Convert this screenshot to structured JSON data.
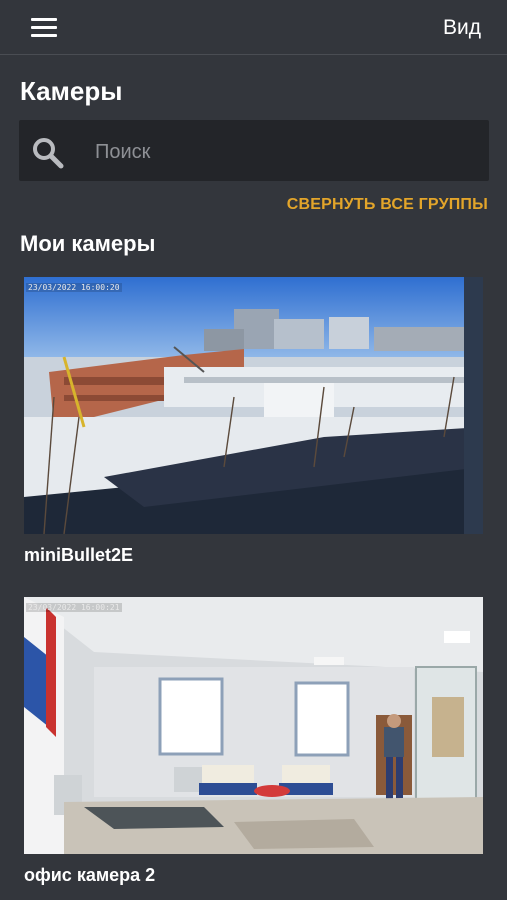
{
  "header": {
    "view_label": "Вид"
  },
  "page": {
    "title": "Камеры"
  },
  "search": {
    "placeholder": "Поиск"
  },
  "actions": {
    "collapse_all": "СВЕРНУТЬ ВСЕ ГРУППЫ"
  },
  "section": {
    "title": "Мои камеры"
  },
  "cameras": [
    {
      "name": "miniBullet2E",
      "timestamp": "23/03/2022 16:00:20"
    },
    {
      "name": "офис камера 2",
      "timestamp": "23/03/2022 16:00:21"
    }
  ],
  "colors": {
    "background": "#33363c",
    "search_bg": "#232529",
    "accent": "#e3a52a"
  }
}
